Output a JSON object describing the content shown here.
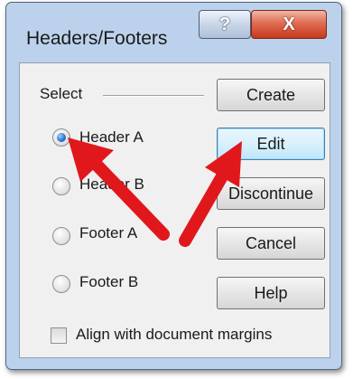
{
  "window": {
    "title": "Headers/Footers",
    "help_glyph": "?",
    "close_glyph": "X"
  },
  "group": {
    "label": "Select",
    "options": [
      {
        "label": "Header A",
        "checked": true
      },
      {
        "label": "Header B",
        "checked": false
      },
      {
        "label": "Footer A",
        "checked": false
      },
      {
        "label": "Footer B",
        "checked": false
      }
    ]
  },
  "buttons": {
    "create": "Create",
    "edit": "Edit",
    "discontinue": "Discontinue",
    "cancel": "Cancel",
    "help": "Help"
  },
  "checkbox": {
    "label": "Align with document margins",
    "checked": false
  },
  "colors": {
    "frame": "#bcd2ec",
    "client": "#f0f0f0",
    "close_button": "#c4391d",
    "annotation_arrow": "#e0181c",
    "radio_selected": "#2a78d2"
  },
  "annotations": [
    {
      "icon": "red-arrow-icon",
      "points_to": "Header A"
    },
    {
      "icon": "red-arrow-icon",
      "points_to": "Edit"
    }
  ]
}
